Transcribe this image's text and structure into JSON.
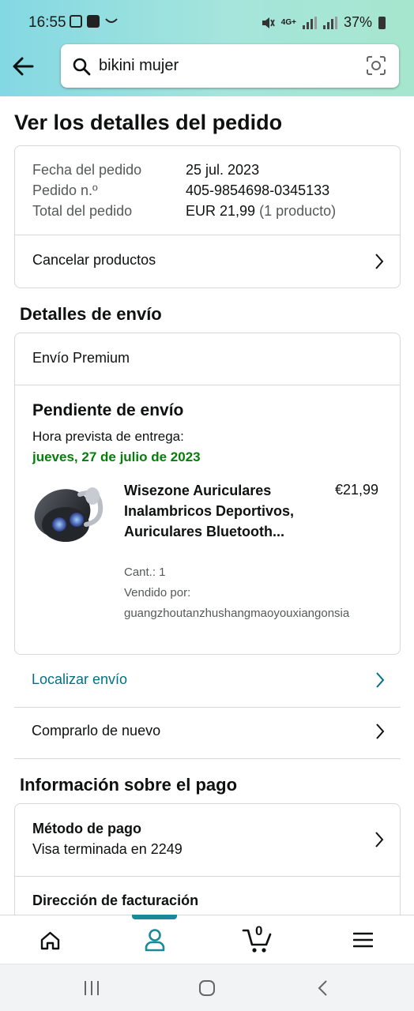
{
  "status_bar": {
    "time": "16:55",
    "network": "4G+",
    "battery": "37%"
  },
  "search": {
    "query": "bikini mujer"
  },
  "page": {
    "title": "Ver los detalles del pedido"
  },
  "order_summary": {
    "rows": [
      {
        "label": "Fecha del pedido",
        "value": "25 jul. 2023"
      },
      {
        "label": "Pedido n.º",
        "value": "405-9854698-0345133"
      },
      {
        "label": "Total del pedido",
        "value": "EUR 21,99",
        "extra": "(1 producto)"
      }
    ],
    "cancel_label": "Cancelar productos"
  },
  "shipping": {
    "section_title": "Detalles de envío",
    "method": "Envío Premium",
    "status": "Pendiente de envío",
    "eta_label": "Hora prevista de entrega:",
    "eta_date": "jueves, 27 de julio de 2023",
    "item": {
      "title": "Wisezone Auriculares Inalambricos Deportivos, Auriculares Bluetooth...",
      "price": "€21,99",
      "qty": "Cant.: 1",
      "seller_label": "Vendido por:",
      "seller": "guangzhoutanzhushangmaoyouxiangonsia"
    },
    "track_label": "Localizar envío",
    "buy_again_label": "Comprarlo de nuevo"
  },
  "payment": {
    "section_title": "Información sobre el pago",
    "method_title": "Método de pago",
    "method_value": "Visa terminada en 2249",
    "billing_title": "Dirección de facturación"
  },
  "bottom_nav": {
    "cart_count": "0"
  },
  "colors": {
    "header_gradient_start": "#84d8e3",
    "header_gradient_end": "#a6e6ce",
    "link": "#007185",
    "success": "#067d0b",
    "nav_indicator": "#1a8a9a",
    "border": "#d5d9d9"
  },
  "icons": [
    "back-arrow-icon",
    "search-icon",
    "camera-lens-icon",
    "chevron-right-icon",
    "home-icon",
    "account-icon",
    "cart-icon",
    "menu-icon"
  ]
}
